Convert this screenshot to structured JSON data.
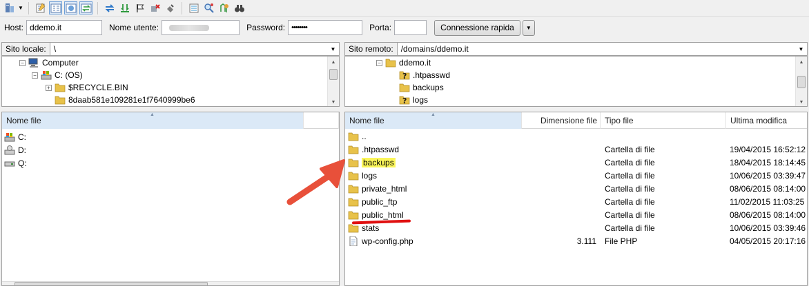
{
  "toolbar": {
    "icons": [
      "site-manager-icon",
      "dropdown-icon",
      "message-log-icon",
      "local-tree-icon",
      "remote-tree-icon",
      "transfer-queue-icon",
      "refresh-icon",
      "process-queue-icon",
      "cancel-icon",
      "disconnect-icon",
      "reconnect-icon",
      "compare-icon",
      "search-icon",
      "sync-browse-icon",
      "find-icon"
    ]
  },
  "quickconnect": {
    "host_label": "Host:",
    "host_value": "ddemo.it",
    "user_label": "Nome utente:",
    "user_value": "",
    "pass_label": "Password:",
    "pass_value": "••••••••",
    "port_label": "Porta:",
    "port_value": "",
    "connect_label": "Connessione rapida",
    "dropdown_glyph": "▼"
  },
  "local": {
    "path_label": "Sito locale:",
    "path_value": "\\",
    "tree": [
      {
        "label": "Computer",
        "icon": "computer-icon",
        "expander": "−"
      },
      {
        "label": "C: (OS)",
        "icon": "drive-c-icon",
        "expander": "−"
      },
      {
        "label": "$RECYCLE.BIN",
        "icon": "folder-icon",
        "expander": "+"
      },
      {
        "label": "8daab581e109281e1f7640999be6",
        "icon": "folder-icon",
        "expander": ""
      }
    ],
    "list_header": "Nome file",
    "files": [
      {
        "name": "C:",
        "icon": "drive-c-icon"
      },
      {
        "name": "D:",
        "icon": "drive-d-icon"
      },
      {
        "name": "Q:",
        "icon": "drive-q-icon"
      }
    ]
  },
  "remote": {
    "path_label": "Sito remoto:",
    "path_value": "/domains/ddemo.it",
    "tree": [
      {
        "label": "ddemo.it",
        "icon": "folder-icon",
        "expander": "−"
      },
      {
        "label": ".htpasswd",
        "icon": "unknown-folder-icon",
        "expander": ""
      },
      {
        "label": "backups",
        "icon": "folder-icon",
        "expander": ""
      },
      {
        "label": "logs",
        "icon": "unknown-folder-icon",
        "expander": ""
      }
    ],
    "columns": {
      "name": "Nome file",
      "size": "Dimensione file",
      "type": "Tipo file",
      "modified": "Ultima modifica"
    },
    "files": [
      {
        "name": "..",
        "size": "",
        "type": "",
        "modified": "",
        "icon": "folder-icon"
      },
      {
        "name": ".htpasswd",
        "size": "",
        "type": "Cartella di file",
        "modified": "19/04/2015 16:52:12",
        "icon": "folder-icon"
      },
      {
        "name": "backups",
        "size": "",
        "type": "Cartella di file",
        "modified": "18/04/2015 18:14:45",
        "icon": "folder-icon"
      },
      {
        "name": "logs",
        "size": "",
        "type": "Cartella di file",
        "modified": "10/06/2015 03:39:47",
        "icon": "folder-icon"
      },
      {
        "name": "private_html",
        "size": "",
        "type": "Cartella di file",
        "modified": "08/06/2015 08:14:00",
        "icon": "folder-icon"
      },
      {
        "name": "public_ftp",
        "size": "",
        "type": "Cartella di file",
        "modified": "11/02/2015 11:03:25",
        "icon": "folder-icon"
      },
      {
        "name": "public_html",
        "size": "",
        "type": "Cartella di file",
        "modified": "08/06/2015 08:14:00",
        "icon": "folder-icon"
      },
      {
        "name": "stats",
        "size": "",
        "type": "Cartella di file",
        "modified": "10/06/2015 03:39:46",
        "icon": "folder-icon"
      },
      {
        "name": "wp-config.php",
        "size": "3.111",
        "type": "File PHP",
        "modified": "04/05/2015 20:17:16",
        "icon": "php-file-icon"
      }
    ]
  },
  "annotations": {
    "highlight_color": "#fbf65a",
    "arrow_color": "#e8503a",
    "underline_color": "#e01010"
  }
}
